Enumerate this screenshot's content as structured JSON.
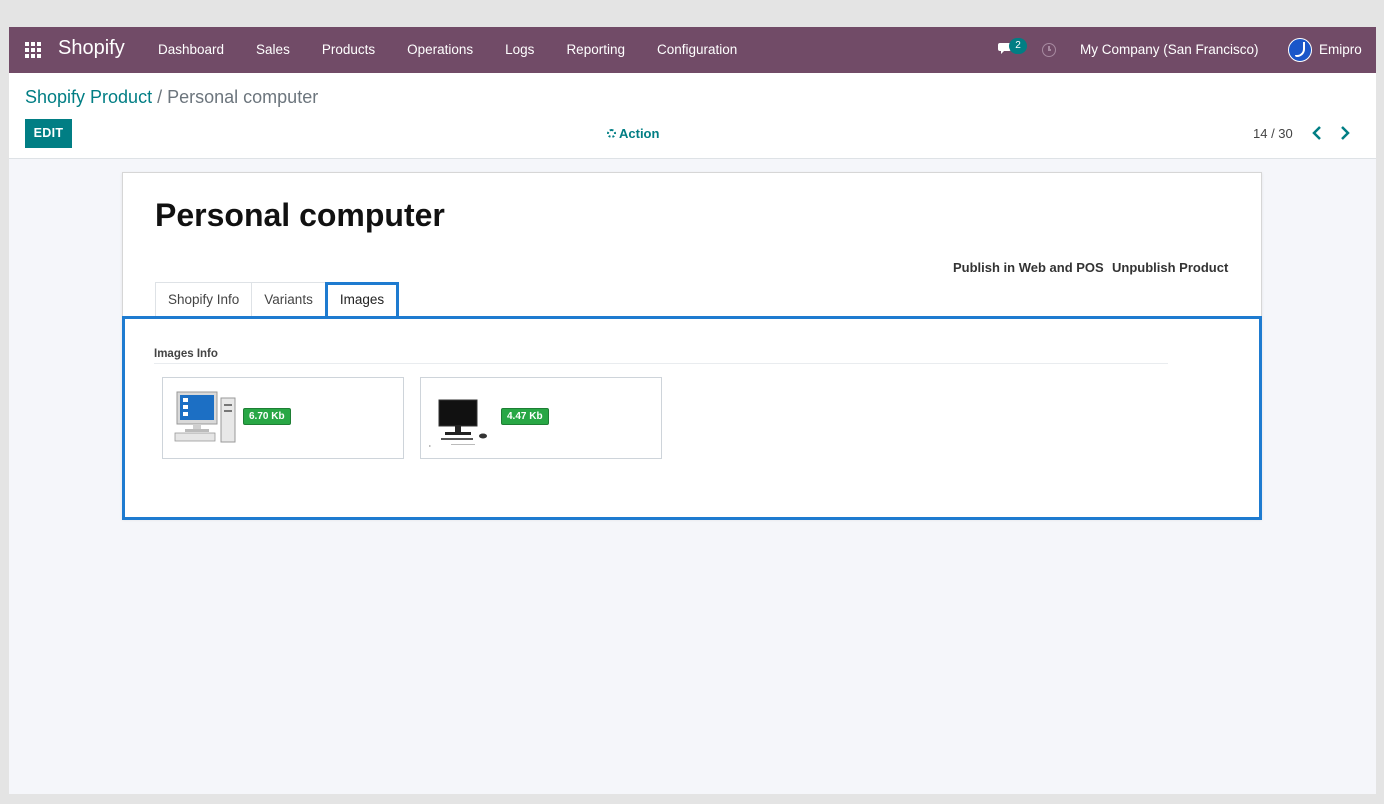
{
  "navbar": {
    "brand": "Shopify",
    "menu": [
      "Dashboard",
      "Sales",
      "Products",
      "Operations",
      "Logs",
      "Reporting",
      "Configuration"
    ],
    "chat_count": "2",
    "company": "My Company (San Francisco)",
    "user": "Emipro"
  },
  "breadcrumb": {
    "parent": "Shopify Product",
    "separator": "/",
    "current": "Personal computer"
  },
  "control": {
    "edit_label": "EDIT",
    "action_label": "Action",
    "pager": "14 / 30"
  },
  "form": {
    "title": "Personal computer",
    "publish_label": "Publish in Web and POS",
    "unpublish_label": "Unpublish Product",
    "tabs": [
      "Shopify Info",
      "Variants",
      "Images"
    ],
    "active_tab": "Images",
    "images_section": "Images Info",
    "images": [
      {
        "size": "6.70 Kb",
        "icon": "desktop-computer-icon"
      },
      {
        "size": "4.47 Kb",
        "icon": "monitor-icon"
      }
    ]
  },
  "colors": {
    "navbar": "#714b67",
    "primary": "#017e84",
    "highlight": "#1e7bd0",
    "badge": "#28a745"
  }
}
